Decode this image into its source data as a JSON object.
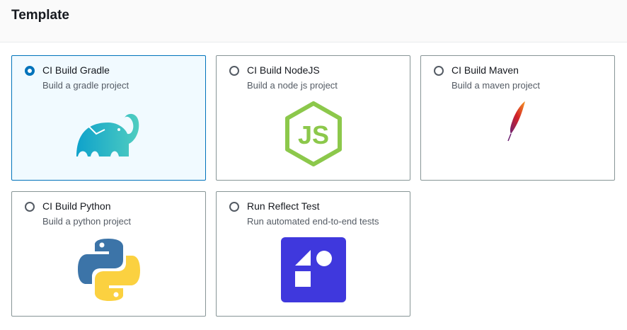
{
  "header": {
    "title": "Template"
  },
  "templates": [
    {
      "label": "CI Build Gradle",
      "description": "Build a gradle project",
      "icon": "gradle-elephant-icon",
      "selected": true
    },
    {
      "label": "CI Build NodeJS",
      "description": "Build a node js project",
      "icon": "nodejs-icon",
      "selected": false
    },
    {
      "label": "CI Build Maven",
      "description": "Build a maven project",
      "icon": "apache-feather-icon",
      "selected": false
    },
    {
      "label": "CI Build Python",
      "description": "Build a python project",
      "icon": "python-icon",
      "selected": false
    },
    {
      "label": "Run Reflect Test",
      "description": "Run automated end-to-end tests",
      "icon": "reflect-icon",
      "selected": false
    }
  ],
  "colors": {
    "selected": "#0073bb",
    "reflect": "#3f38dd",
    "node": "#8cc84b"
  }
}
